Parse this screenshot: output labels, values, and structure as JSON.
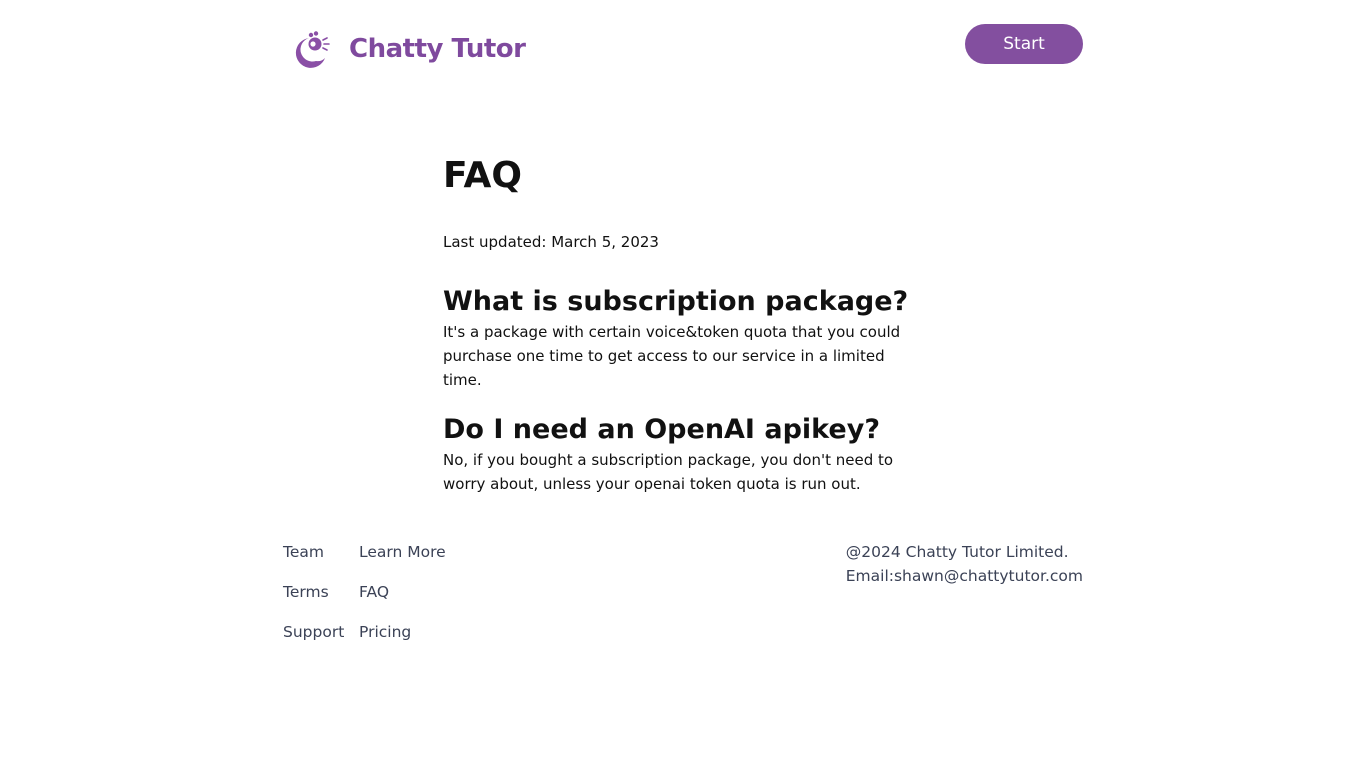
{
  "header": {
    "brand_name": "Chatty Tutor",
    "start_label": "Start",
    "brand_color": "#7f4a9e",
    "button_color": "#834f9f"
  },
  "main": {
    "title": "FAQ",
    "last_updated": "Last updated: March 5, 2023",
    "faqs": [
      {
        "question": "What is subscription package?",
        "answer": "It's a package with certain voice&token quota that you could purchase one time to get access to our service in a limited time."
      },
      {
        "question": "Do I need an OpenAI apikey?",
        "answer": "No, if you bought a subscription package, you don't need to worry about, unless your openai token quota is run out."
      }
    ]
  },
  "footer": {
    "col1": [
      "Team",
      "Terms",
      "Support"
    ],
    "col2": [
      "Learn More",
      "FAQ",
      "Pricing"
    ],
    "copyright": "@2024 Chatty Tutor Limited.",
    "email": "Email:shawn@chattytutor.com"
  },
  "icons": {
    "logo": "chatty-tutor-logo-icon"
  }
}
